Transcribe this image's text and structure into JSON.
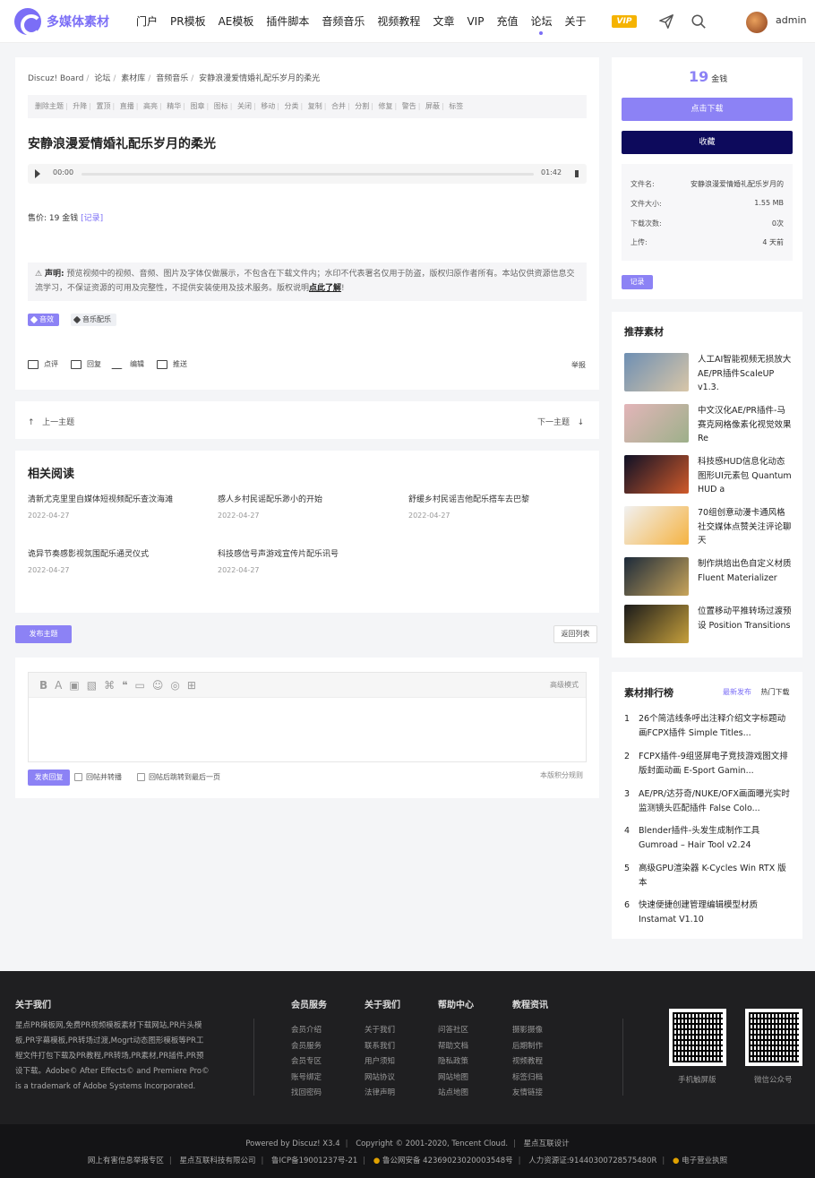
{
  "header": {
    "logo_text": "多媒体素材",
    "nav": [
      "门户",
      "PR模板",
      "AE模板",
      "插件脚本",
      "音频音乐",
      "视频教程",
      "文章",
      "VIP",
      "充值",
      "论坛",
      "关于"
    ],
    "active_nav": "论坛",
    "vip_label": "VIP",
    "user_name": "admin"
  },
  "breadcrumb": [
    "Discuz! Board",
    "论坛",
    "素材库",
    "音频音乐",
    "安静浪漫爱情婚礼配乐岁月的柔光"
  ],
  "mod_tools": [
    "删除主题",
    "升降",
    "置顶",
    "直播",
    "高亮",
    "精华",
    "图章",
    "图标",
    "关闭",
    "移动",
    "分类",
    "复制",
    "合并",
    "分割",
    "修复",
    "警告",
    "屏蔽",
    "标签"
  ],
  "thread": {
    "title": "安静浪漫爱情婚礼配乐岁月的柔光",
    "player_current": "00:00",
    "player_total": "01:42",
    "price_label": "售价: 19 金钱",
    "price_link": "[记录]",
    "notice_bold": "声明:",
    "notice_text": "预览视频中的视频、音频、图片及字体仅做展示，不包含在下载文件内；水印不代表署名仅用于防盗，版权归原作者所有。本站仅供资源信息交流学习，不保证资源的可用及完整性，不提供安装使用及技术服务。版权说明",
    "notice_link": "点此了解",
    "notice_end": "!",
    "tags": [
      "音效",
      "音乐配乐"
    ],
    "actions": [
      "点评",
      "回复",
      "编辑",
      "推送"
    ],
    "report": "举报"
  },
  "pager": {
    "prev": "上一主题",
    "next": "下一主题"
  },
  "related": {
    "title": "相关阅读",
    "items": [
      {
        "title": "清新尤克里里自媒体短视频配乐查汶海滩",
        "date": "2022-04-27"
      },
      {
        "title": "感人乡村民谣配乐渺小的开始",
        "date": "2022-04-27"
      },
      {
        "title": "舒缓乡村民谣吉他配乐搭车去巴黎",
        "date": "2022-04-27"
      },
      {
        "title": "诡异节奏感影视氛围配乐通灵仪式",
        "date": "2022-04-27"
      },
      {
        "title": "科技感信号声游戏宣传片配乐讯号",
        "date": "2022-04-27"
      }
    ]
  },
  "buttons": {
    "post": "发布主题",
    "back": "返回列表"
  },
  "editor": {
    "toolbar": [
      "B",
      "A",
      "▣",
      "▧",
      "⌘",
      "❝",
      "▭",
      "☺",
      "◎",
      "⊞"
    ],
    "advanced": "高级模式",
    "reply": "发表回复",
    "check1": "回帖并转播",
    "check2": "回帖后跳转到最后一页",
    "rules": "本版积分规则"
  },
  "sidebar": {
    "coin_value": "19",
    "coin_unit": "金钱",
    "download": "点击下载",
    "favorite": "收藏",
    "file": [
      {
        "k": "文件名:",
        "v": "安静浪漫爱情婚礼配乐岁月的"
      },
      {
        "k": "文件大小:",
        "v": "1.55 MB"
      },
      {
        "k": "下载次数:",
        "v": "0次"
      },
      {
        "k": "上传:",
        "v": "4 天前"
      }
    ],
    "log": "记录",
    "recommend_title": "推荐素材",
    "recommend": [
      {
        "title": "人工AI智能视频无损放大AE/PR插件ScaleUP v1.3.",
        "color1": "#6e8fb3",
        "color2": "#d8c6a8"
      },
      {
        "title": "中文汉化AE/PR插件-马赛克网格像素化视觉效果 Re",
        "color1": "#e3b5b9",
        "color2": "#9db08a"
      },
      {
        "title": "科技感HUD信息化动态图形UI元素包 Quantum HUD a",
        "color1": "#0e1026",
        "color2": "#d05a2a"
      },
      {
        "title": "70组创意动漫卡通风格社交媒体点赞关注评论聊天",
        "color1": "#f1f1f1",
        "color2": "#f5b342"
      },
      {
        "title": "制作烘焙出色自定义材质 Fluent Materializer",
        "color1": "#1c2a3a",
        "color2": "#c8a45a"
      },
      {
        "title": "位置移动平推转场过渡预设 Position Transitions",
        "color1": "#1a1a1a",
        "color2": "#c6a03c"
      }
    ],
    "rank_title": "素材排行榜",
    "rank_tabs": [
      "最新发布",
      "热门下载"
    ],
    "rank": [
      "26个简洁线条呼出注释介绍文字标题动画FCPX插件 Simple Titles...",
      "FCPX插件-9组竖屏电子竞技游戏图文排版封面动画 E-Sport Gamin...",
      "AE/PR/达芬奇/NUKE/OFX画面曝光实时监测镜头匹配插件 False Colo...",
      "Blender插件-头发生成制作工具 Gumroad – Hair Tool v2.24",
      "高级GPU渲染器 K-Cycles Win RTX 版本",
      "快速便捷创建管理编辑模型材质 Instamat V1.10"
    ]
  },
  "footer": {
    "about_title": "关于我们",
    "about_text": "星点PR模板网,免费PR视频模板素材下载网站,PR片头模板,PR字幕模板,PR转场过渡,Mogrt动态图形模板等PR工程文件打包下载及PR教程,PR转场,PR素材,PR插件,PR预设下载。Adobe© After Effects© and Premiere Pro© is a trademark of Adobe Systems Incorporated.",
    "columns": [
      {
        "h": "会员服务",
        "links": [
          "会员介绍",
          "会员服务",
          "会员专区",
          "账号绑定",
          "找回密码"
        ]
      },
      {
        "h": "关于我们",
        "links": [
          "关于我们",
          "联系我们",
          "用户须知",
          "网站协议",
          "法律声明"
        ]
      },
      {
        "h": "帮助中心",
        "links": [
          "问答社区",
          "帮助文档",
          "隐私政策",
          "网站地图",
          "站点地图"
        ]
      },
      {
        "h": "教程资讯",
        "links": [
          "摄影摄像",
          "后期制作",
          "视频教程",
          "标签归档",
          "友情链接"
        ]
      }
    ],
    "qr1": "手机触屏版",
    "qr2": "微信公众号",
    "powered": [
      "Powered by Discuz! X3.4",
      "Copyright © 2001-2020, Tencent Cloud.",
      "星点互联设计"
    ],
    "icp": [
      "网上有害信息举报专区",
      "星点互联科技有限公司",
      "鲁ICP备19001237号-21",
      "鲁公网安备 42369023020003548号",
      "人力资源证:91440300728575480R",
      "电子营业执照"
    ]
  }
}
